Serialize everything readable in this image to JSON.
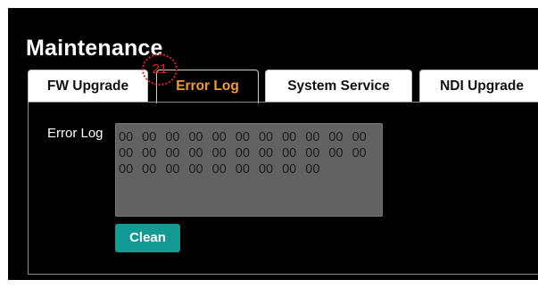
{
  "page": {
    "title": "Maintenance"
  },
  "tabs": [
    {
      "label": "FW Upgrade",
      "active": false
    },
    {
      "label": "Error Log",
      "active": true
    },
    {
      "label": "System Service",
      "active": false
    },
    {
      "label": "NDI Upgrade",
      "active": false
    }
  ],
  "error_log": {
    "label": "Error Log",
    "value": "00 00 00 00 00 00 00 00 00 00 00 00 00 00 00 00 00 00 00 00 00 00 00 00 00 00 00 00 00 00 00",
    "clean_button": "Clean"
  },
  "callout": {
    "number": "21",
    "color": "#e1251b"
  },
  "colors": {
    "background": "#000000",
    "active_tab_text": "#f39c33",
    "button": "#129a93",
    "log_area": "#626262"
  }
}
